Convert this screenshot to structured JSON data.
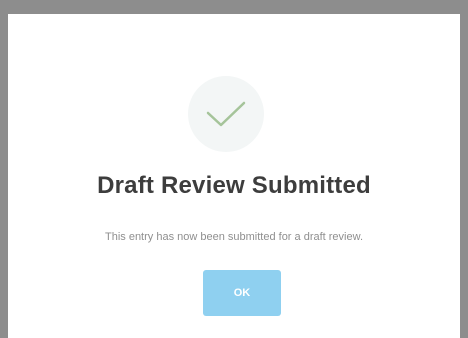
{
  "dialog": {
    "icon": "checkmark-icon",
    "title": "Draft Review Submitted",
    "message": "This entry has now been submitted for a draft review.",
    "ok_label": "OK"
  },
  "colors": {
    "backdrop": "#8d8d8d",
    "dialog_background": "#ffffff",
    "icon_circle": "#f3f6f6",
    "checkmark": "#a5c49a",
    "title_text": "#3d3d3d",
    "message_text": "#8f8f8f",
    "button_background": "#8fd0f0",
    "button_text": "#ffffff"
  }
}
